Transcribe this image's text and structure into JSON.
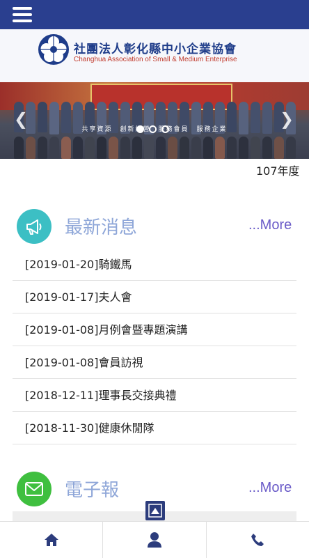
{
  "header": {
    "menu_icon": "hamburger-menu-icon",
    "bar_color": "#2a3f8f"
  },
  "logo": {
    "title": "社團法人彰化縣中小企業協會",
    "subtitle": "Changhua Association of Small & Medium Enterprise",
    "mark_color": "#1f3d8a"
  },
  "banner": {
    "caption": "共享資源　創新經營　服務會員　服務企業",
    "prev_icon": "chevron-left-icon",
    "next_icon": "chevron-right-icon",
    "slides": 3,
    "active_slide": 1
  },
  "marquee": {
    "text": "107年度"
  },
  "news": {
    "title": "最新消息",
    "icon": "megaphone-icon",
    "icon_color": "#3cbfc4",
    "more_label": "...More",
    "items": [
      "[2019-01-20]騎鐵馬",
      "[2019-01-17]夫人會",
      "[2019-01-08]月例會暨專題演講",
      "[2019-01-08]會員訪視",
      "[2018-12-11]理事長交接典禮",
      "[2018-11-30]健康休閒隊"
    ]
  },
  "newsletter": {
    "title": "電子報",
    "icon": "envelope-icon",
    "icon_color": "#3fbf3f",
    "more_label": "...More"
  },
  "back_to_top_icon": "arrow-up-icon",
  "bottom_nav": {
    "home_icon": "home-icon",
    "member_icon": "user-icon",
    "contact_icon": "phone-icon",
    "icon_color": "#2c3c7c"
  }
}
